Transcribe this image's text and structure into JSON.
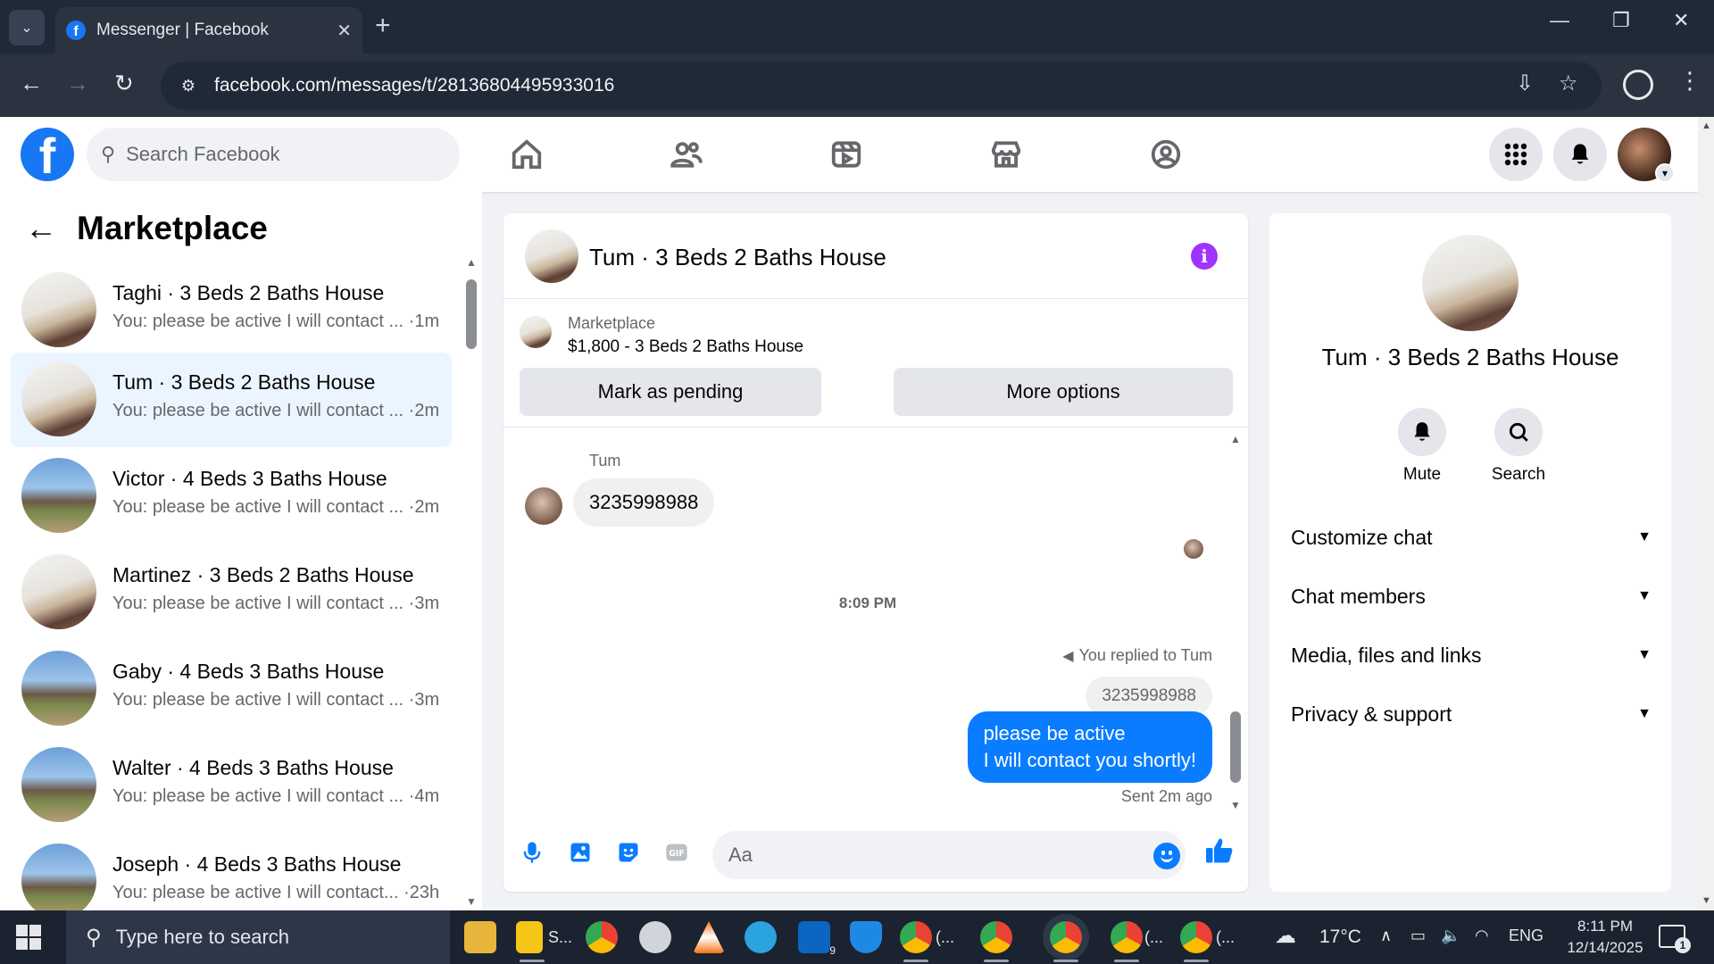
{
  "browser": {
    "tab_title": "Messenger | Facebook",
    "url": "facebook.com/messages/t/28136804495933016"
  },
  "fb": {
    "search_placeholder": "Search Facebook",
    "brand_color": "#1877f2"
  },
  "sidebar": {
    "title": "Marketplace",
    "conversations": [
      {
        "name": "Taghi · 3 Beds 2 Baths House",
        "preview": "You: please be active I will contact ... ·1m",
        "thumb": "interior",
        "active": false
      },
      {
        "name": "Tum · 3 Beds 2 Baths House",
        "preview": "You: please be active I will contact ... ·2m",
        "thumb": "interior",
        "active": true
      },
      {
        "name": "Victor · 4 Beds 3 Baths House",
        "preview": "You: please be active I will contact ... ·2m",
        "thumb": "exterior",
        "active": false
      },
      {
        "name": "Martinez · 3 Beds 2 Baths House",
        "preview": "You: please be active I will contact ... ·3m",
        "thumb": "interior",
        "active": false
      },
      {
        "name": "Gaby · 4 Beds 3 Baths House",
        "preview": "You: please be active I will contact ... ·3m",
        "thumb": "exterior",
        "active": false
      },
      {
        "name": "Walter · 4 Beds 3 Baths House",
        "preview": "You: please be active I will contact ... ·4m",
        "thumb": "exterior",
        "active": false
      },
      {
        "name": "Joseph · 4 Beds 3 Baths House",
        "preview": "You: please be active I will contact... ·23h",
        "thumb": "exterior",
        "active": false
      }
    ]
  },
  "chat": {
    "title": "Tum · 3 Beds 2 Baths House",
    "listing": {
      "source": "Marketplace",
      "price_title": "$1,800 - 3 Beds 2 Baths House",
      "mark_pending_label": "Mark as pending",
      "more_options_label": "More options"
    },
    "messages": {
      "sender": "Tum",
      "incoming_text": "3235998988",
      "time_separator": "8:09 PM",
      "reply_note": "You replied to Tum",
      "quoted_text": "3235998988",
      "outgoing_line1": "please be active",
      "outgoing_line2": "I will contact you shortly!",
      "status": "Sent 2m ago"
    },
    "composer_placeholder": "Aa",
    "accent_color": "#0a7cff"
  },
  "info_panel": {
    "title": "Tum · 3 Beds 2 Baths House",
    "mute_label": "Mute",
    "search_label": "Search",
    "sections": [
      "Customize chat",
      "Chat members",
      "Media, files and links",
      "Privacy & support"
    ]
  },
  "taskbar": {
    "search_placeholder": "Type here to search",
    "app_label_s": "S...",
    "app_label_paren": "(...",
    "linkedin_badge": "9",
    "temperature": "17°C",
    "language": "ENG",
    "time": "8:11 PM",
    "date": "12/14/2025",
    "notification_count": "1"
  }
}
